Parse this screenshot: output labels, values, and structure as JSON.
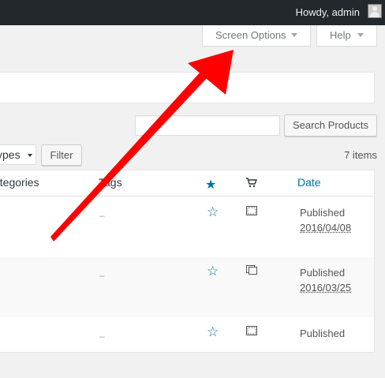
{
  "adminbar": {
    "howdy": "Howdy, admin"
  },
  "tabs": {
    "screen_options": "Screen Options",
    "help": "Help"
  },
  "search": {
    "placeholder": "",
    "button": "Search Products"
  },
  "filter": {
    "type_select": "ypes",
    "button": "Filter"
  },
  "items_count": "7 items",
  "columns": {
    "categories": "ategories",
    "tags": "Tags",
    "date": "Date"
  },
  "rows": [
    {
      "tags": "–",
      "status": "Published",
      "date": "2016/04/08"
    },
    {
      "tags": "–",
      "status": "Published",
      "date": "2016/03/25"
    },
    {
      "tags": "–",
      "status": "Published",
      "date": ""
    }
  ],
  "colors": {
    "accent": "#0073aa",
    "arrow": "#ff0000",
    "adminbar": "#23282d"
  },
  "icons": {
    "featured": "star-icon",
    "type": "product-type-icon",
    "cart": "cart-icon"
  }
}
